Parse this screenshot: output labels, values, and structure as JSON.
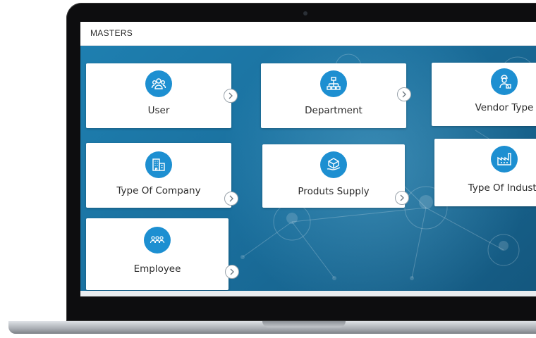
{
  "header": {
    "title": "MASTERS"
  },
  "cards": [
    {
      "label": "User",
      "icon": "users-group-icon"
    },
    {
      "label": "Department",
      "icon": "org-chart-icon"
    },
    {
      "label": "Vendor Type",
      "icon": "vendor-worker-icon"
    },
    {
      "label": "Type Of Company",
      "icon": "building-icon"
    },
    {
      "label": "Produts Supply",
      "icon": "supply-box-icon"
    },
    {
      "label": "Type Of Industry",
      "icon": "factory-icon"
    },
    {
      "label": "Employee",
      "icon": "employees-icon"
    }
  ],
  "colors": {
    "accent": "#1d8fd1",
    "background": "#1a6f9d"
  }
}
